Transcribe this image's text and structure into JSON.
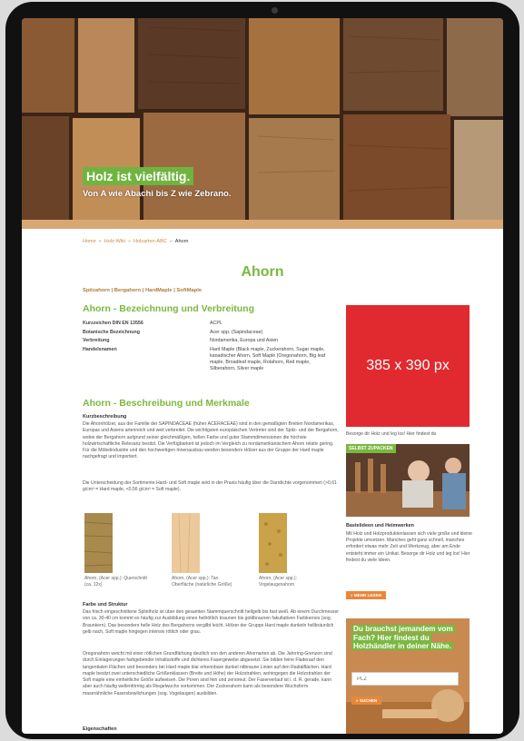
{
  "hero": {
    "title": "Holz ist vielfältig.",
    "subtitle": "Von A wie Abachi bis Z wie Zebrano."
  },
  "breadcrumbs": [
    "Home",
    "Holz-Wiki",
    "Holzarten-ABC",
    "Ahorn"
  ],
  "page_title": "Ahorn",
  "synonyms": "Spitzahorn | Bergahorn | HardMaple | SoftMaple",
  "section1": {
    "heading": "Ahorn - Bezeichnung und Verbreitung",
    "rows": [
      {
        "key": "Kurzzeichen DIN EN 13556",
        "value": "ACPL"
      },
      {
        "key": "Botanische Bezeichnung",
        "value": "Acer spp. (Sapindaceae)"
      },
      {
        "key": "Verbreitung",
        "value": "Nordamerika, Europa und Asien"
      },
      {
        "key": "Handelsnamen",
        "value": "Hard Maple (Black maple, Zuckerahorn, Sugar maple, kanadischer Ahorn, Soft Maple (Oregonahorn, Big leaf maple, Broadleaf maple, Rotahorn, Red maple, Silberahorn, Silver maple"
      }
    ]
  },
  "section2": {
    "heading": "Ahorn - Beschreibung und Merkmale",
    "short_label": "Kurzbeschreibung",
    "p1": "Die Ahornhölzer, aus der Familie der SAPINDACEAE (früher ACERACEAE) sind in den gemäßigten Breiten Nordamerikas, Europas und Asiens artenreich und weit verbreitet. Die wichtigsten europäischen Vertreter sind der Spitz- und der Bergahorn, wobei der Bergahorn aufgrund seiner gleichmäßigen, hellen Farbe und guter Stammdimensionen die höchste holzwirtschaftliche Relevanz besitzt. Die Verfügbarkeit ist jedoch im Vergleich zu nordamerikanischem Ahorn relativ gering. Für die Möbelindustrie und den hochwertigen Innenausbau werden besonders Hölzer aus der Gruppe der Hard maple nachgefragt und importiert.",
    "p2": "Die Unterscheidung der Sortimente Hard- und Soft maple wird in der Praxis häufig über die Darrdichte vorgenommen (>0,61 g/cm³ = Hard maple, <0,56 g/cm³ = Soft maple).",
    "swatches": [
      {
        "caption": "Ahorn, (Acer spp.): Querschnitt (ca. 12x)",
        "color": "#a98a4e"
      },
      {
        "caption": "Ahorn, (Acer spp.): Tan. Oberfläche (natürliche Größe)",
        "color": "#ecc99a"
      },
      {
        "caption": "Ahorn, (Acer spp.): Vogelaugenahorn",
        "color": "#c9a24a"
      }
    ],
    "struct_label": "Farbe und Struktur",
    "p3": "Das frisch eingeschnittene Splintholz ist über den gesamten Stammquerschnitt hellgelb bis fast weiß. Ab einem Durchmesser von ca. 30-40 cm kommt es häufig zur Ausbildung eines hellrötlich braunen bis goldbraunen fakultativen Farbkernes (sog. Braunkern). Das besonders helle Holz des Bergahorns vergilbt leicht. Hölzer der Gruppe Hard maple dunkeln hellbräunlich gelb nach, Soft maple hingegen intensiv rötlich oder grau.",
    "p4": "Oregonahorn weicht mit einer rötlichen Grundfärbung deutlich von den anderen Ahornarten ab. Die Jahrring-Grenzen sind durch Einlagerungen farbgebender Inhaltsstoffe und dichteres Fasergewebe abgesetzt. Sie bilden feine Fladerauf den tangentialen Flächen und besonders bei Hard maple klar erkennbare dunkel nitbraune Linien auf den Radialflächen. Hard maple besitzt zwei unterschiedliche Größenklassen (Breite und Höhe) der Holzstrahlen, wohingegen die Holzstrahlen der Soft maple eine einheitliche Größe aufweisen. Die Poren sind fein und zerstreut. Der Faserverlauf ist i. d. R. gerade, kann aber auch häufig wellenförmig als Riegelwuchs vorkommen. Der Zuckerahorn kann als besondere Wuchsform maserähnliche Fasersbewlichungen (sog. Vogelaugen) ausbilden.",
    "next_label": "Eigenschaften"
  },
  "sidebar": {
    "ad_label": "385 x 390 px",
    "teaser_text": "Besorge dir Holz und leg los! Hier findest du",
    "badge": "SELBST ZUPACKEN",
    "card_title": "Bastelideen und Heimwerken",
    "card_text": "Mit Holz und Holzproduktenlassen sich viele große und kleine Projekte umsetzen. Manches geht ganz schnell, manches erfordert etwas mehr Zeit und Werkzeug, aber am Ende entsteht immer ein Unikat. Besorge dir Holz und leg los! Hier findest du viele Ideen.",
    "more_button": "» MEHR LESEN",
    "dealer_title": "Du brauchst jemandem vom Fach? Hier findest du Holzhändler in deiner Nähe.",
    "plz_placeholder": "PLZ",
    "search_button": "» SUCHEN"
  },
  "colors": {
    "accent_green": "#7ab840",
    "accent_orange": "#e8873a",
    "ad_red": "#e02a2f"
  }
}
